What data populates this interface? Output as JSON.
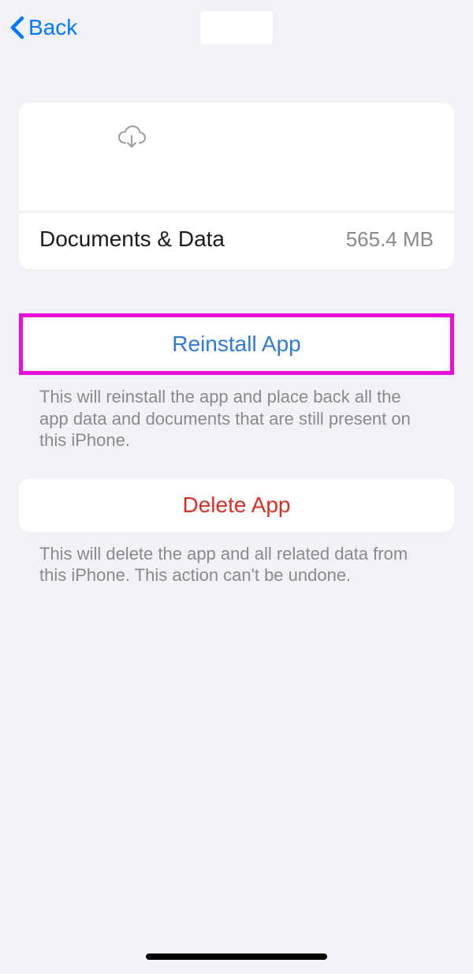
{
  "nav": {
    "back_label": "Back"
  },
  "app_info": {
    "documents_label": "Documents & Data",
    "documents_size": "565.4 MB"
  },
  "actions": {
    "reinstall_label": "Reinstall App",
    "reinstall_footer": "This will reinstall the app and place back all the app data and documents that are still present on this iPhone.",
    "delete_label": "Delete App",
    "delete_footer": "This will delete the app and all related data from this iPhone. This action can't be undone."
  }
}
